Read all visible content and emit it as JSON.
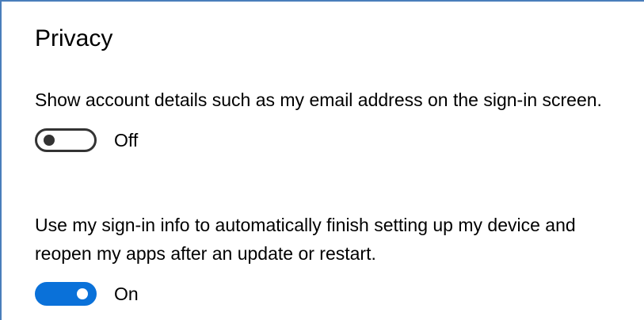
{
  "privacy": {
    "title": "Privacy",
    "settings": [
      {
        "description": "Show account details such as my email address on the sign-in screen.",
        "state_label": "Off",
        "enabled": false
      },
      {
        "description": "Use my sign-in info to automatically finish setting up my device and reopen my apps after an update or restart.",
        "state_label": "On",
        "enabled": true
      }
    ]
  },
  "colors": {
    "accent": "#0a71d9",
    "border": "#4a7ebb",
    "toggle_off": "#333333"
  }
}
